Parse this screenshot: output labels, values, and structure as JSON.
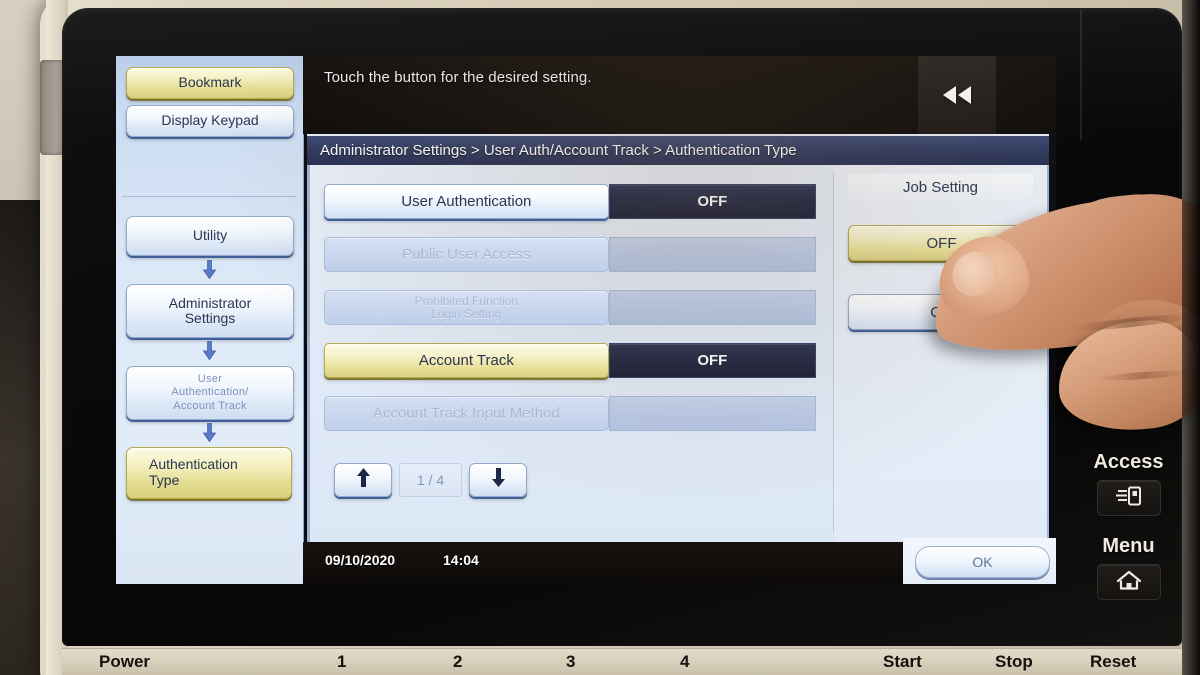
{
  "hint": {
    "text": "Touch the button for the desired setting.",
    "back_icon": "rewind-back-icon"
  },
  "breadcrumb": {
    "text": "Administrator Settings > User Auth/Account Track > Authentication Type"
  },
  "sidebar": {
    "buttons": [
      {
        "label": "Bookmark",
        "state": "selected"
      },
      {
        "label": "Display Keypad",
        "state": "normal"
      }
    ],
    "path": [
      {
        "label": "Utility",
        "state": "normal"
      },
      {
        "label": "Administrator Settings",
        "line1": "Administrator",
        "line2": "Settings",
        "state": "normal"
      },
      {
        "label": "User Authentication/ Account Track",
        "line1": "User",
        "line2": "Authentication/",
        "line3": "Account Track",
        "state": "dim"
      },
      {
        "label": "Authentication Type",
        "line1": "Authentication",
        "line2": "Type",
        "state": "selected"
      }
    ],
    "arrow_icon": "arrow-down-icon"
  },
  "settings": {
    "rows": [
      {
        "label": "User Authentication",
        "value": "OFF",
        "state": "enabled"
      },
      {
        "label": "Public User Access",
        "value": "",
        "state": "disabled"
      },
      {
        "label": "Prohibited Function Login Setting",
        "line1": "Prohibited Function",
        "line2": "Login Setting",
        "value": "",
        "state": "disabled"
      },
      {
        "label": "Account Track",
        "value": "OFF",
        "state": "selected"
      },
      {
        "label": "Account Track Input Method",
        "value": "",
        "state": "disabled"
      }
    ],
    "pager": {
      "up_icon": "arrow-up-icon",
      "down_icon": "arrow-down-icon",
      "page": "1 / 4"
    }
  },
  "job_setting": {
    "title": "Job Setting",
    "options": [
      {
        "label": "OFF",
        "state": "selected"
      },
      {
        "label": "ON",
        "state": "normal"
      }
    ]
  },
  "status": {
    "date": "09/10/2020",
    "time": "14:04",
    "ok_label": "OK"
  },
  "hardware": {
    "power_icon": "power-ring-icon",
    "keys": [
      {
        "label": "Access",
        "icon": "access-card-icon"
      },
      {
        "label": "Menu",
        "icon": "home-icon"
      }
    ],
    "legend": [
      "Power",
      "1",
      "2",
      "3",
      "4",
      "Start",
      "Stop",
      "Reset"
    ]
  },
  "colors": {
    "selected": "#e7df98",
    "value_dark": "#232942",
    "breadcrumb": "#2f3a60",
    "screen_bg": "#e2ebf7",
    "sidebar_bg": "#dae7f6"
  }
}
